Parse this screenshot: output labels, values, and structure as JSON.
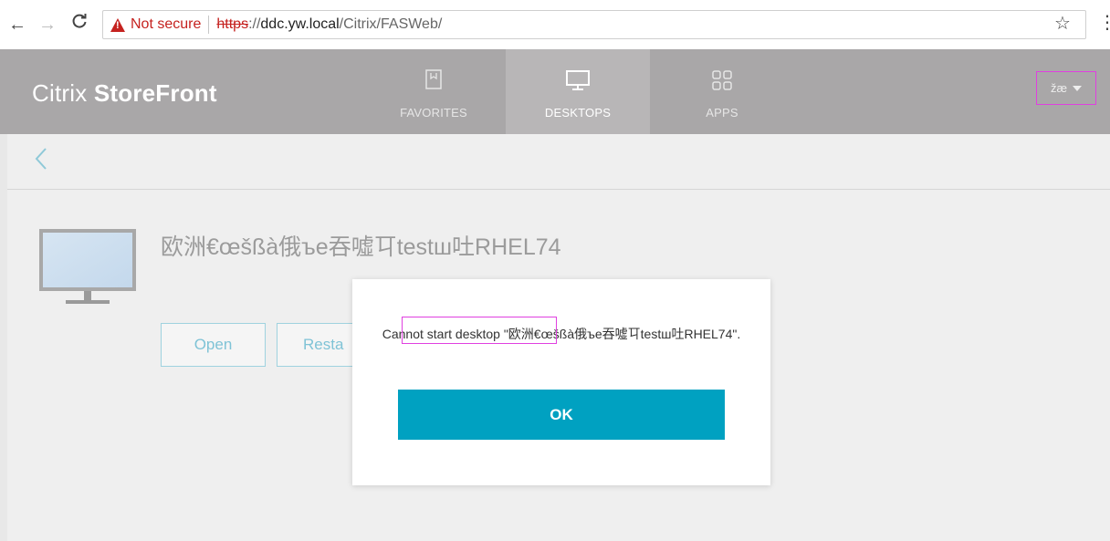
{
  "browser": {
    "security_text": "Not secure",
    "url_scheme": "https",
    "url_sep": "://",
    "url_host": "ddc.yw.local",
    "url_path": "/Citrix/FASWeb/"
  },
  "header": {
    "brand_light": "Citrix ",
    "brand_bold": "StoreFront",
    "tabs": [
      {
        "label": "FAVORITES",
        "icon": "bookmark-icon"
      },
      {
        "label": "DESKTOPS",
        "icon": "monitor-icon"
      },
      {
        "label": "APPS",
        "icon": "apps-grid-icon"
      }
    ],
    "user_label": "žæ"
  },
  "desktop": {
    "name": "欧洲€œšßà俄ъe吞噓㔿testш吐RHEL74",
    "open_label": "Open",
    "restart_label": "Resta"
  },
  "dialog": {
    "message": "Cannot start desktop \"欧洲€œšßà俄ъe吞噓㔿testш吐RHEL74\".",
    "ok_label": "OK"
  },
  "colors": {
    "accent": "#00a1c1",
    "header_bg": "#bebcbd",
    "warning": "#c5221f"
  }
}
